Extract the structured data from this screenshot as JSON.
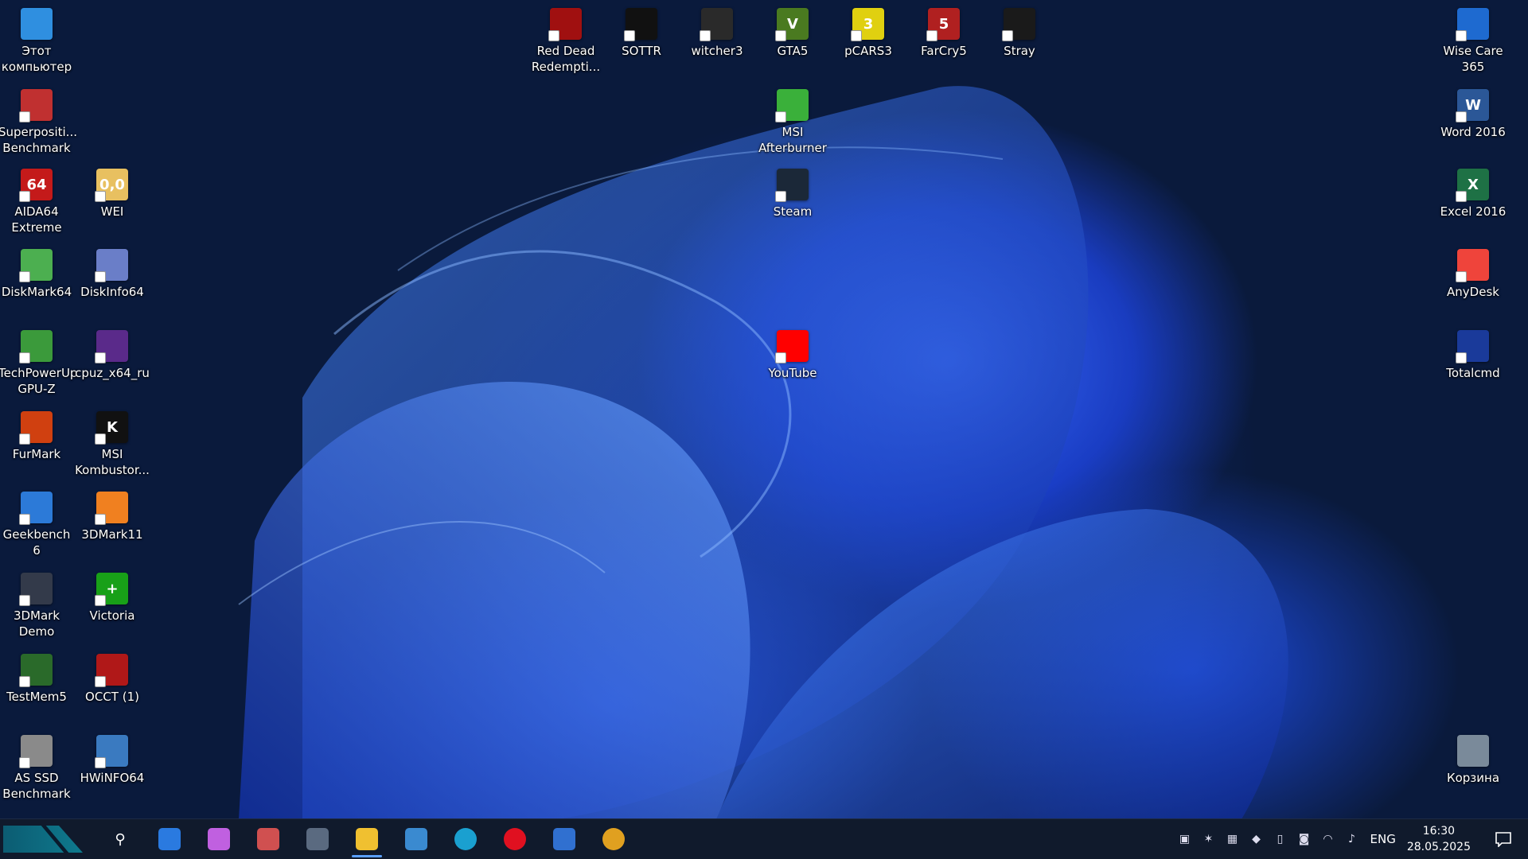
{
  "desktop_icons": [
    {
      "label": "Этот\nкомпьютер",
      "icon": "computer-icon",
      "color": "#2f8fe0"
    },
    {
      "label": "Superpositi...\nBenchmark",
      "icon": "superposition-icon",
      "color": "#c03030"
    },
    {
      "label": "AIDA64\nExtreme",
      "icon": "aida64-icon",
      "color": "#c41a1a",
      "glyph": "64"
    },
    {
      "label": "WEI",
      "icon": "wei-icon",
      "color": "#e8c060",
      "glyph": "0,0"
    },
    {
      "label": "DiskMark64",
      "icon": "diskmark-icon",
      "color": "#4caf50"
    },
    {
      "label": "DiskInfo64",
      "icon": "diskinfo-icon",
      "color": "#6a7ec8"
    },
    {
      "label": "TechPowerUp\nGPU-Z",
      "icon": "gpuz-icon",
      "color": "#3b9a3b"
    },
    {
      "label": "cpuz_x64_ru",
      "icon": "cpuz-icon",
      "color": "#5a2a8a"
    },
    {
      "label": "FurMark",
      "icon": "furmark-icon",
      "color": "#d04010"
    },
    {
      "label": "MSI\nKombustor...",
      "icon": "kombustor-icon",
      "color": "#111111",
      "glyph": "K"
    },
    {
      "label": "Geekbench 6",
      "icon": "geekbench-icon",
      "color": "#2c7ad8"
    },
    {
      "label": "3DMark11",
      "icon": "3dmark11-icon",
      "color": "#f08020"
    },
    {
      "label": "3DMark\nDemo",
      "icon": "3dmark-demo-icon",
      "color": "#333a4a"
    },
    {
      "label": "Victoria",
      "icon": "victoria-icon",
      "color": "#18a018",
      "glyph": "+"
    },
    {
      "label": "TestMem5",
      "icon": "testmem-icon",
      "color": "#2a6a2a"
    },
    {
      "label": "OCCT (1)",
      "icon": "occt-icon",
      "color": "#b01818"
    },
    {
      "label": "AS SSD\nBenchmark",
      "icon": "asssd-icon",
      "color": "#8a8a8a"
    },
    {
      "label": "HWiNFO64",
      "icon": "hwinfo-icon",
      "color": "#3a7ac0"
    },
    {
      "label": "Red Dead\nRedempti...",
      "icon": "rdr2-icon",
      "color": "#a01010"
    },
    {
      "label": "SOTTR",
      "icon": "sottr-icon",
      "color": "#111111"
    },
    {
      "label": "witcher3",
      "icon": "witcher-icon",
      "color": "#2a2a2a"
    },
    {
      "label": "GTA5",
      "icon": "gta5-icon",
      "color": "#4a7a20",
      "glyph": "V"
    },
    {
      "label": "pCARS3",
      "icon": "pcars-icon",
      "color": "#e0d010",
      "glyph": "3"
    },
    {
      "label": "FarCry5",
      "icon": "farcry-icon",
      "color": "#b02020",
      "glyph": "5"
    },
    {
      "label": "Stray",
      "icon": "stray-icon",
      "color": "#1a1a1a"
    },
    {
      "label": "MSI\nAfterburner",
      "icon": "afterburner-icon",
      "color": "#3ab03a"
    },
    {
      "label": "Steam",
      "icon": "steam-icon",
      "color": "#1b2838"
    },
    {
      "label": "YouTube",
      "icon": "youtube-icon",
      "color": "#ff0000"
    },
    {
      "label": "Wise Care\n365",
      "icon": "wisecare-icon",
      "color": "#1e6ad0"
    },
    {
      "label": "Word 2016",
      "icon": "word-icon",
      "color": "#2b5797",
      "glyph": "W"
    },
    {
      "label": "Excel 2016",
      "icon": "excel-icon",
      "color": "#1e7145",
      "glyph": "X"
    },
    {
      "label": "AnyDesk",
      "icon": "anydesk-icon",
      "color": "#ef443b"
    },
    {
      "label": "Totalcmd",
      "icon": "totalcmd-icon",
      "color": "#1a3a9a"
    },
    {
      "label": "Корзина",
      "icon": "recycle-bin-icon",
      "color": "#7a8a9a"
    }
  ],
  "taskbar": {
    "apps": [
      {
        "name": "search-icon",
        "color": "#101a2c",
        "glyph": "⚲"
      },
      {
        "name": "widgets-icon",
        "color": "#2a7ae0"
      },
      {
        "name": "copilot-icon",
        "color": "#c060e0"
      },
      {
        "name": "paint-icon",
        "color": "#d05050"
      },
      {
        "name": "calculator-icon",
        "color": "#5a6a80"
      },
      {
        "name": "file-explorer-icon",
        "color": "#f0c030",
        "active": true
      },
      {
        "name": "control-panel-icon",
        "color": "#3a8ad0"
      },
      {
        "name": "edge-icon",
        "color": "#1aa0d0"
      },
      {
        "name": "opera-icon",
        "color": "#e01020"
      },
      {
        "name": "store-icon",
        "color": "#3070d0"
      },
      {
        "name": "chrome-icon",
        "color": "#e0a020"
      }
    ],
    "tray": {
      "language": "ENG",
      "time": "16:30",
      "date": "28.05.2025"
    }
  },
  "colors": {
    "taskbar_bg": "#101a2c",
    "wallpaper_blue": "#1e5af0"
  }
}
